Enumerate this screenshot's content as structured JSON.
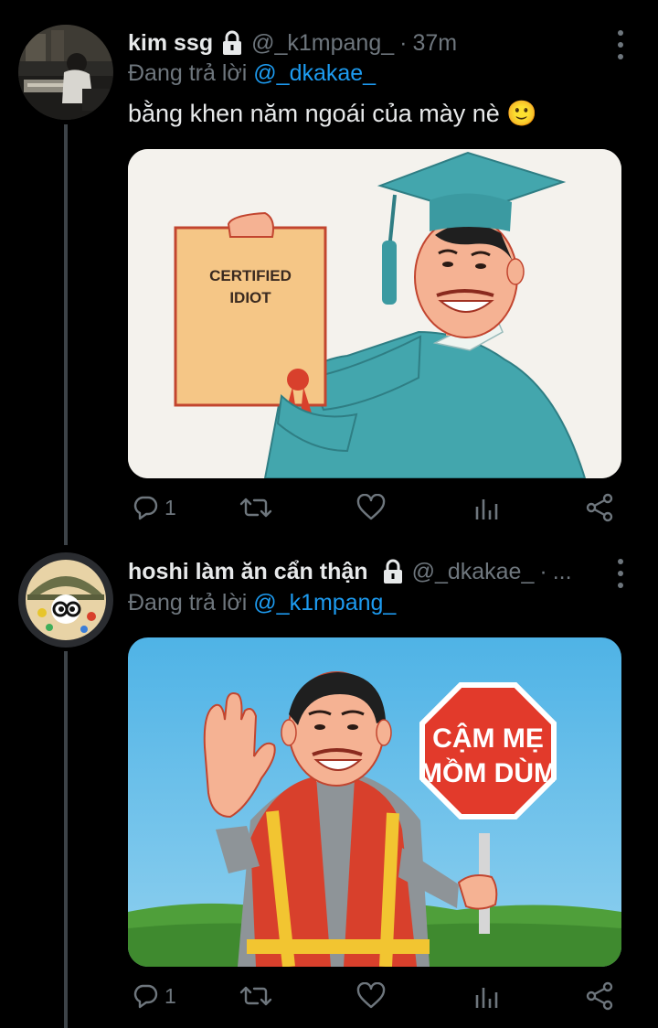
{
  "tweets": [
    {
      "name": "kim ssg",
      "handle": "@_k1mpang_",
      "separator": "·",
      "time": "37m",
      "reply_prefix": "Đang trả lời ",
      "reply_to": "@_dkakae_",
      "text": "bằng khen năm ngoái của mày nè 🙂",
      "media": {
        "sign_line1": "CERTIFIED",
        "sign_line2": "IDIOT"
      },
      "reply_count": "1"
    },
    {
      "name": "hoshi làm ăn cẩn thận",
      "handle": "@_dkakae_",
      "separator": "·",
      "time": "...",
      "reply_prefix": "Đang trả lời ",
      "reply_to": "@_k1mpang_",
      "media": {
        "sign_line1": "CẬM MẸ",
        "sign_line2": "MỒM DÙM"
      },
      "reply_count": "1"
    }
  ],
  "colors": {
    "background": "#000000",
    "text": "#e7e9ea",
    "muted": "#6e767d",
    "link": "#1d9bf0",
    "thread_line": "#3d4348"
  },
  "icons": [
    "lock-icon",
    "more-vertical-icon",
    "reply-icon",
    "retweet-icon",
    "like-icon",
    "analytics-icon",
    "share-icon"
  ]
}
